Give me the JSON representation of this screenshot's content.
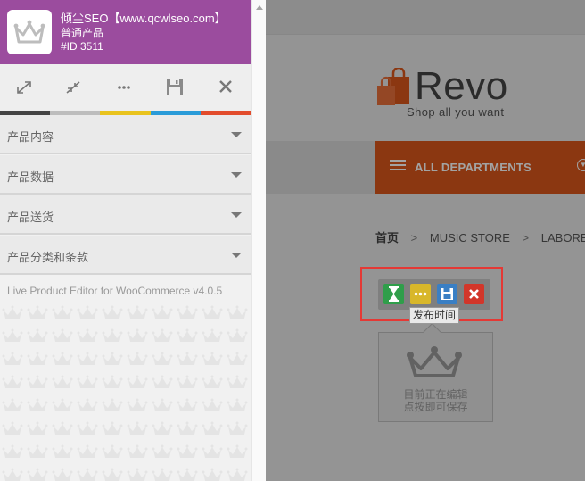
{
  "panel": {
    "title": "倾尘SEO【www.qcwlseo.com】",
    "product_type": "普通产品",
    "product_id": "#ID 3511",
    "toolbar_icons": [
      "expand-icon",
      "collapse-icon",
      "more-icon",
      "save-icon",
      "close-icon"
    ],
    "color_strip": [
      "#444444",
      "#bdbdbd",
      "#e9c31e",
      "#2a9bd8",
      "#e24c2c"
    ],
    "sections": [
      {
        "label": "产品内容"
      },
      {
        "label": "产品数据"
      },
      {
        "label": "产品送货"
      },
      {
        "label": "产品分类和条款"
      }
    ],
    "version_text": "Live Product Editor for WooCommerce v4.0.5",
    "header_color": "#9b4c9e"
  },
  "shop": {
    "logo_word": "Revo",
    "logo_tagline": "Shop all you want",
    "departments_label": "ALL DEPARTMENTS",
    "breadcrumb": {
      "home": "首页",
      "separator": ">",
      "items": [
        "MUSIC STORE",
        "LABORE"
      ]
    },
    "product_placeholder": {
      "line1": "目前正在编辑",
      "line2": "点按即可保存"
    },
    "accent_color": "#d9561b"
  },
  "edit_toolbar": {
    "buttons": [
      {
        "icon": "hourglass-icon",
        "color": "#2f9e4a"
      },
      {
        "icon": "more-icon",
        "color": "#d8b72a"
      },
      {
        "icon": "save-icon",
        "color": "#3a7fc4"
      },
      {
        "icon": "close-icon",
        "color": "#d2362a"
      }
    ],
    "tooltip": "发布时间"
  }
}
